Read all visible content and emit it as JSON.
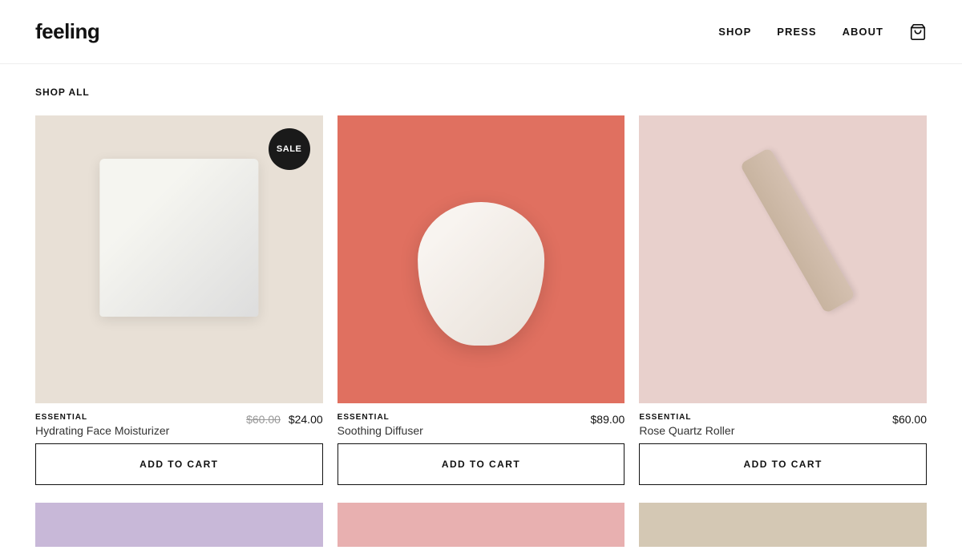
{
  "header": {
    "logo": "feeling",
    "nav": [
      {
        "label": "SHOP",
        "id": "shop"
      },
      {
        "label": "PRESS",
        "id": "press"
      },
      {
        "label": "ABOUT",
        "id": "about"
      }
    ],
    "cart_icon_label": "cart"
  },
  "page": {
    "section_label": "SHOP ALL"
  },
  "products": [
    {
      "id": "product-1",
      "category": "ESSENTIAL",
      "name": "Hydrating Face Moisturizer",
      "price_original": "$60.00",
      "price_sale": "$24.00",
      "has_sale": true,
      "sale_badge": "SALE",
      "add_to_cart_label": "ADD TO CART",
      "image_class": "img-moisturizer"
    },
    {
      "id": "product-2",
      "category": "ESSENTIAL",
      "name": "Soothing Diffuser",
      "price": "$89.00",
      "has_sale": false,
      "add_to_cart_label": "ADD TO CART",
      "image_class": "img-diffuser"
    },
    {
      "id": "product-3",
      "category": "ESSENTIAL",
      "name": "Rose Quartz Roller",
      "price": "$60.00",
      "has_sale": false,
      "add_to_cart_label": "ADD TO CART",
      "image_class": "img-roller"
    }
  ],
  "colors": {
    "accent": "#1a1a1a",
    "sale_badge_bg": "#1a1a1a",
    "sale_badge_text": "#ffffff"
  }
}
